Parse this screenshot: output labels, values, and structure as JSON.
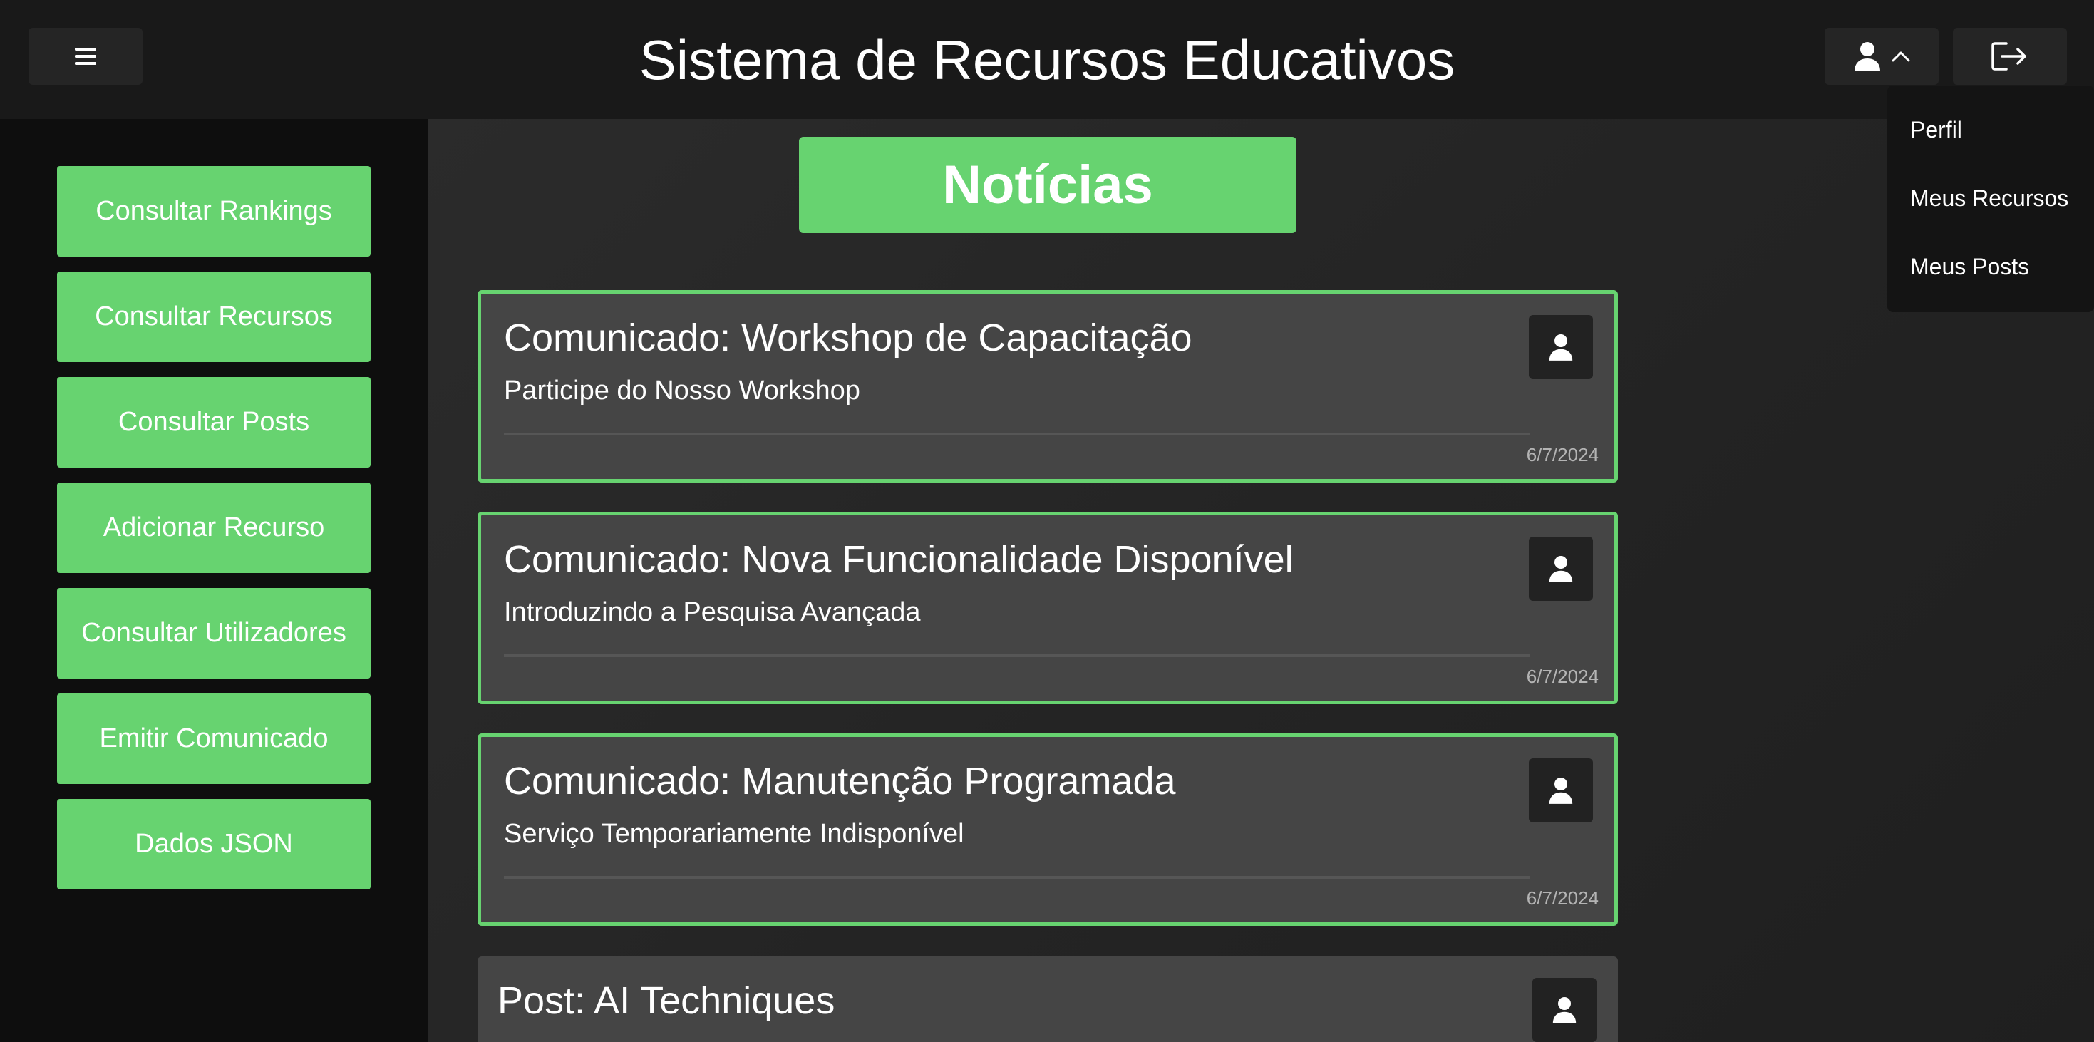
{
  "header": {
    "title": "Sistema de Recursos Educativos",
    "menu_icon": "hamburger-icon",
    "user_icon": "user-icon",
    "user_chevron_icon": "chevron-up-icon",
    "logout_icon": "logout-icon"
  },
  "user_dropdown": {
    "items": [
      "Perfil",
      "Meus Recursos",
      "Meus Posts"
    ]
  },
  "sidebar": {
    "items": [
      "Consultar Rankings",
      "Consultar Recursos",
      "Consultar Posts",
      "Adicionar Recurso",
      "Consultar Utilizadores",
      "Emitir Comunicado",
      "Dados JSON"
    ]
  },
  "main": {
    "heading": "Notícias",
    "cards": [
      {
        "title": "Comunicado: Workshop de Capacitação",
        "subtitle": "Participe do Nosso Workshop",
        "date": "6/7/2024"
      },
      {
        "title": "Comunicado: Nova Funcionalidade Disponível",
        "subtitle": "Introduzindo a Pesquisa Avançada",
        "date": "6/7/2024"
      },
      {
        "title": "Comunicado: Manutenção Programada",
        "subtitle": "Serviço Temporariamente Indisponível",
        "date": "6/7/2024"
      },
      {
        "title": "Post: AI Techniques"
      }
    ]
  },
  "colors": {
    "accent": "#67d370",
    "header_bg": "#191919",
    "sidebar_bg": "#0e0e0e",
    "card_bg": "#454545"
  }
}
